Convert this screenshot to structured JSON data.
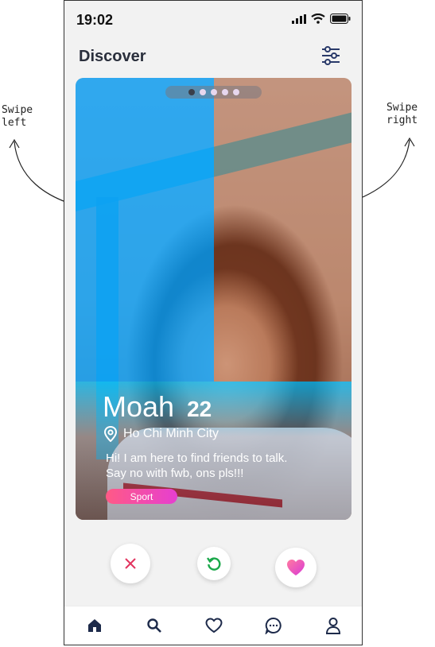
{
  "status_bar": {
    "time": "19:02"
  },
  "header": {
    "title": "Discover"
  },
  "card": {
    "name": "Moah",
    "age": "22",
    "location": "Ho Chi Minh City",
    "bio_line1": "Hi! I am here to find friends to talk.",
    "bio_line2": "Say no with fwb, ons pls!!!",
    "tag": "Sport",
    "photo_count": 5,
    "active_photo": 1
  },
  "annotations": {
    "left_line1": "Swipe",
    "left_line2": "left",
    "right_line1": "Swipe",
    "right_line2": "right"
  },
  "colors": {
    "accent_pink": "#ff4f9a",
    "dislike": "#e2345f",
    "rewind": "#1aa84a",
    "nav": "#1d2a4a"
  },
  "nav": [
    "home-icon",
    "search-icon",
    "heart-icon",
    "chat-icon",
    "profile-icon"
  ]
}
